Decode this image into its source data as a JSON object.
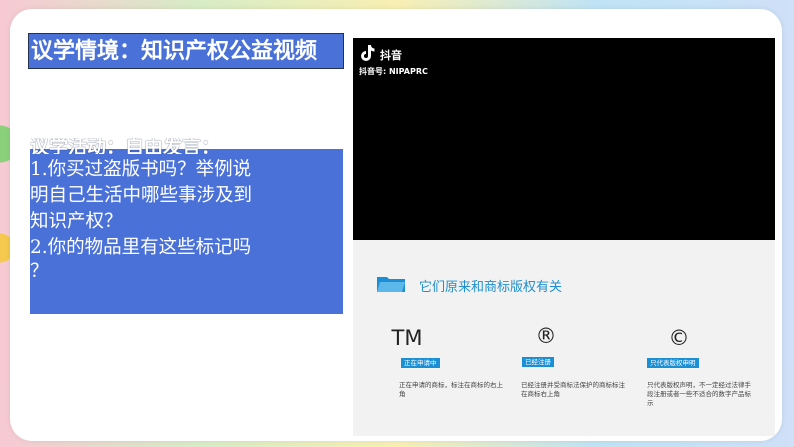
{
  "title": "议学情境：知识产权公益视频",
  "activity": {
    "heading": "议学活动：自由发言：",
    "lines": [
      "1.你买过盗版书吗？举例说",
      "明自己生活中哪些事涉及到",
      "知识产权？",
      "2.你的物品里有这些标记吗",
      "？"
    ]
  },
  "video": {
    "brand": "抖音",
    "account": "抖音号: NIPAPRC"
  },
  "info": {
    "title": "它们原来和商标版权有关",
    "items": [
      {
        "symbol": "TM",
        "badge": "正在申请中",
        "desc": "正在申请的商标，标注在商标的右上角"
      },
      {
        "symbol": "®",
        "badge": "已经注册",
        "desc": "已经注册并受商标法保护的商标标注在商标右上角"
      },
      {
        "symbol": "©",
        "badge": "只代表版权申明",
        "desc": "只代表版权声明，不一定经过法律手段注册或者一些不适合的数字产品标示"
      }
    ]
  },
  "colors": {
    "panel_blue": "#4a71d8",
    "info_blue": "#1f8fcd",
    "badge_blue": "#1b8fd6"
  }
}
